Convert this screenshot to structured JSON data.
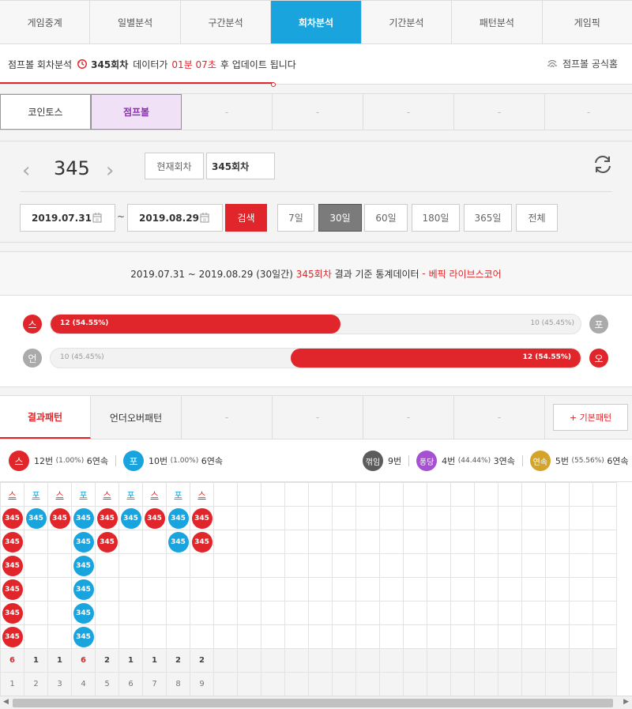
{
  "colors": {
    "red": "#e0262a",
    "blue": "#1aa4dd",
    "purple": "#a650d2",
    "dark": "#5c5c5c",
    "gold": "#d4a428"
  },
  "nav": {
    "tabs": [
      "게임중계",
      "일별분석",
      "구간분석",
      "회차분석",
      "기간분석",
      "패턴분석",
      "게임픽"
    ],
    "active": "회차분석"
  },
  "notice": {
    "prefix": "점프볼 회차분석",
    "round": "345회차",
    "mid": "데이터가",
    "time": "01분 07초",
    "suffix": "후 업데이트 됩니다",
    "official": "점프볼 공식홈"
  },
  "game_tabs": {
    "items": [
      "코인토스",
      "점프볼",
      "-",
      "-",
      "-",
      "-",
      "-"
    ],
    "active": "점프볼"
  },
  "controls": {
    "round": "345",
    "current_label": "현재회차",
    "round_input": "345회차",
    "date_from": "2019.07.31",
    "date_to": "2019.08.29",
    "tilde": "~",
    "search_label": "검색",
    "periods": [
      "7일",
      "30일",
      "60일",
      "180일",
      "365일",
      "전체"
    ],
    "active_period": "30일"
  },
  "stats": {
    "header": {
      "range": "2019.07.31 ~ 2019.08.29 (30일간)",
      "round": "345회차",
      "mid": "결과 기준 통계데이터",
      "dash": "-",
      "brand": "베픽 라이브스코어"
    },
    "row1": {
      "left_ball": "스",
      "right_ball": "포",
      "left_label": "12 (54.55%)",
      "right_label": "10 (45.45%)",
      "left_fraction": 0.5455
    },
    "row2": {
      "left_ball": "언",
      "right_ball": "오",
      "left_label": "10 (45.45%)",
      "right_label": "12 (54.55%)",
      "right_fraction": 0.5455
    }
  },
  "pattern": {
    "tabs": [
      "결과패턴",
      "언더오버패턴",
      "-",
      "-",
      "-",
      "-"
    ],
    "active_tab": "결과패턴",
    "basic_button": "+ 기본패턴",
    "summary": {
      "s_ball": "스",
      "s_count": "12번",
      "s_pct": "(1.00%)",
      "s_streak": "6연속",
      "p_ball": "포",
      "p_count": "10번",
      "p_pct": "(1.00%)",
      "p_streak": "6연속",
      "k_ball": "꺾임",
      "k_count": "9번",
      "d_ball": "퐁당",
      "d_count": "4번",
      "d_pct": "(44.44%)",
      "d_streak": "3연속",
      "y_ball": "연속",
      "y_count": "5번",
      "y_pct": "(55.56%)",
      "y_streak": "6연속"
    },
    "columns": [
      {
        "head": "스",
        "type": "s",
        "count": 6,
        "index": 1
      },
      {
        "head": "포",
        "type": "p",
        "count": 1,
        "index": 2
      },
      {
        "head": "스",
        "type": "s",
        "count": 1,
        "index": 3
      },
      {
        "head": "포",
        "type": "p",
        "count": 6,
        "index": 4
      },
      {
        "head": "스",
        "type": "s",
        "count": 2,
        "index": 5
      },
      {
        "head": "포",
        "type": "p",
        "count": 1,
        "index": 6
      },
      {
        "head": "스",
        "type": "s",
        "count": 1,
        "index": 7
      },
      {
        "head": "포",
        "type": "p",
        "count": 2,
        "index": 8
      },
      {
        "head": "스",
        "type": "s",
        "count": 2,
        "index": 9
      }
    ],
    "ball_label": "345",
    "total_columns": 26,
    "rows": 6
  }
}
